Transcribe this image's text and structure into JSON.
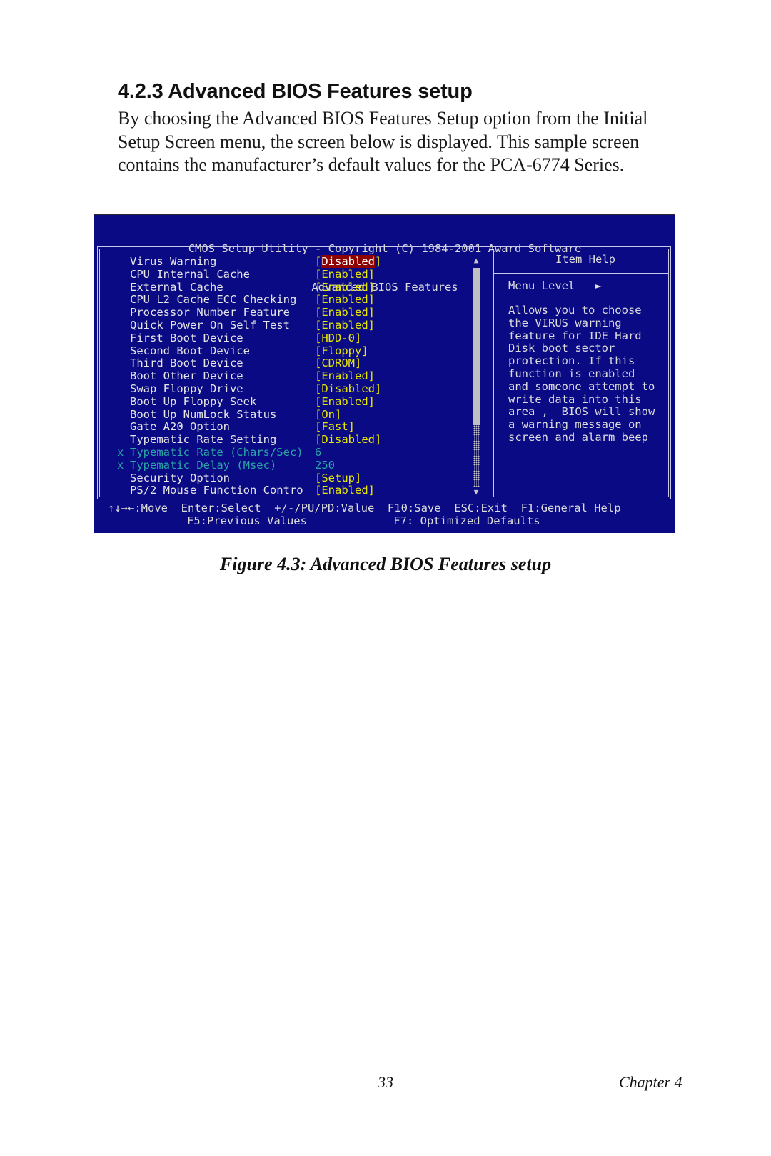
{
  "document": {
    "heading": "4.2.3 Advanced BIOS Features setup",
    "intro_lines": [
      "By choosing the Advanced BIOS Features Setup option from the Initial",
      "Setup Screen menu, the screen below is displayed. This sample screen",
      "contains the manufacturer’s default values for the PCA-6774 Series."
    ],
    "caption": "Figure 4.3: Advanced BIOS Features setup",
    "page_number": "33",
    "chapter": "Chapter 4"
  },
  "bios": {
    "colors": {
      "background": "#0a0a84",
      "value": "#e8e800",
      "disabled": "#2aa6a6",
      "highlight": "#8c0000"
    },
    "header_line1": "CMOS Setup Utility - Copyright (C) 1984-2001 Award Software",
    "header_line2": "Advanced BIOS Features",
    "items": [
      {
        "label": "Virus Warning",
        "value": "Disabled",
        "selected": true
      },
      {
        "label": "CPU Internal Cache",
        "value": "Enabled"
      },
      {
        "label": "External Cache",
        "value": "Enabled"
      },
      {
        "label": "CPU L2 Cache ECC Checking",
        "value": "Enabled"
      },
      {
        "label": "Processor Number Feature",
        "value": "Enabled"
      },
      {
        "label": "Quick Power On Self Test",
        "value": "Enabled"
      },
      {
        "label": "First Boot Device",
        "value": "HDD-0"
      },
      {
        "label": "Second Boot Device",
        "value": "Floppy"
      },
      {
        "label": "Third Boot Device",
        "value": "CDROM"
      },
      {
        "label": "Boot Other Device",
        "value": "Enabled"
      },
      {
        "label": "Swap Floppy Drive",
        "value": "Disabled"
      },
      {
        "label": "Boot Up Floppy Seek",
        "value": "Enabled"
      },
      {
        "label": "Boot Up NumLock Status",
        "value": "On"
      },
      {
        "label": "Gate A20 Option",
        "value": "Fast"
      },
      {
        "label": "Typematic Rate Setting",
        "value": "Disabled"
      },
      {
        "label": "Typematic Rate (Chars/Sec)",
        "value": "6",
        "disabled": true
      },
      {
        "label": "Typematic Delay (Msec)",
        "value": "250",
        "disabled": true
      },
      {
        "label": "Security Option",
        "value": "Setup"
      },
      {
        "label": "PS/2 Mouse Function Contro",
        "value": "Enabled"
      }
    ],
    "disabled_marker": "x",
    "scrollbar": {
      "up_icon": "▲",
      "down_icon": "▼"
    },
    "help": {
      "title": "Item Help",
      "menu_level": "Menu Level",
      "menu_level_icon": "►",
      "text_lines": [
        "Allows you to choose",
        "the VIRUS warning",
        "feature for IDE Hard",
        "Disk boot sector",
        "protection. If this",
        "function is enabled",
        "and someone attempt to",
        "write data into this",
        "area ,  BIOS will show",
        "a warning message on",
        "screen and alarm beep"
      ]
    },
    "footer": {
      "line1": "↑↓→←:Move  Enter:Select  +/-/PU/PD:Value  F10:Save  ESC:Exit  F1:General Help",
      "line2": "F5:Previous Values             F7: Optimized Defaults"
    }
  }
}
